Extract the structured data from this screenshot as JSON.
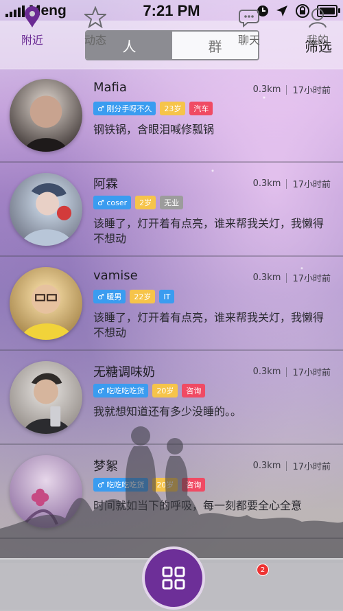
{
  "status_bar": {
    "carrier": "Meng",
    "time": "7:21 PM",
    "icons": [
      "clock-icon",
      "location-arrow-icon",
      "rotation-lock-icon",
      "battery-icon"
    ]
  },
  "header": {
    "segments": [
      "人",
      "群"
    ],
    "selected_segment": "人",
    "filter_label": "筛选"
  },
  "list": {
    "items": [
      {
        "name": "Mafia",
        "distance": "0.3km",
        "time": "17小时前",
        "tags": [
          "♂ 刚分手呀不久",
          "23岁",
          "汽车"
        ],
        "desc": "钢铁锅，含眼泪喊修瓢锅"
      },
      {
        "name": "阿霖",
        "distance": "0.3km",
        "time": "17小时前",
        "tags": [
          "♂ coser",
          "2岁",
          "无业"
        ],
        "desc": "该睡了，灯开着有点亮，谁来帮我关灯，我懒得不想动"
      },
      {
        "name": "vamise",
        "distance": "0.3km",
        "time": "17小时前",
        "tags": [
          "♂ 暖男",
          "22岁",
          "IT"
        ],
        "desc": "该睡了，灯开着有点亮，谁来帮我关灯，我懒得不想动"
      },
      {
        "name": "无糖调味奶",
        "distance": "0.3km",
        "time": "17小时前",
        "tags": [
          "♂ 吃吃吃吃货",
          "20岁",
          "咨询"
        ],
        "desc": "我就想知道还有多少没睡的。。"
      },
      {
        "name": "梦絮",
        "distance": "0.3km",
        "time": "17小时前",
        "tags": [
          "♂ 吃吃吃吃货",
          "20岁",
          "咨询"
        ],
        "desc": "时间就如当下的呼吸，每一刻都要全心全意"
      }
    ]
  },
  "tabbar": {
    "tabs": [
      "附近",
      "动态",
      "聊天",
      "我的"
    ],
    "active_tab": "附近",
    "chat_badge": "2",
    "colors": {
      "active": "#6a2a93",
      "inactive": "#666666",
      "badge": "#e33333"
    }
  }
}
